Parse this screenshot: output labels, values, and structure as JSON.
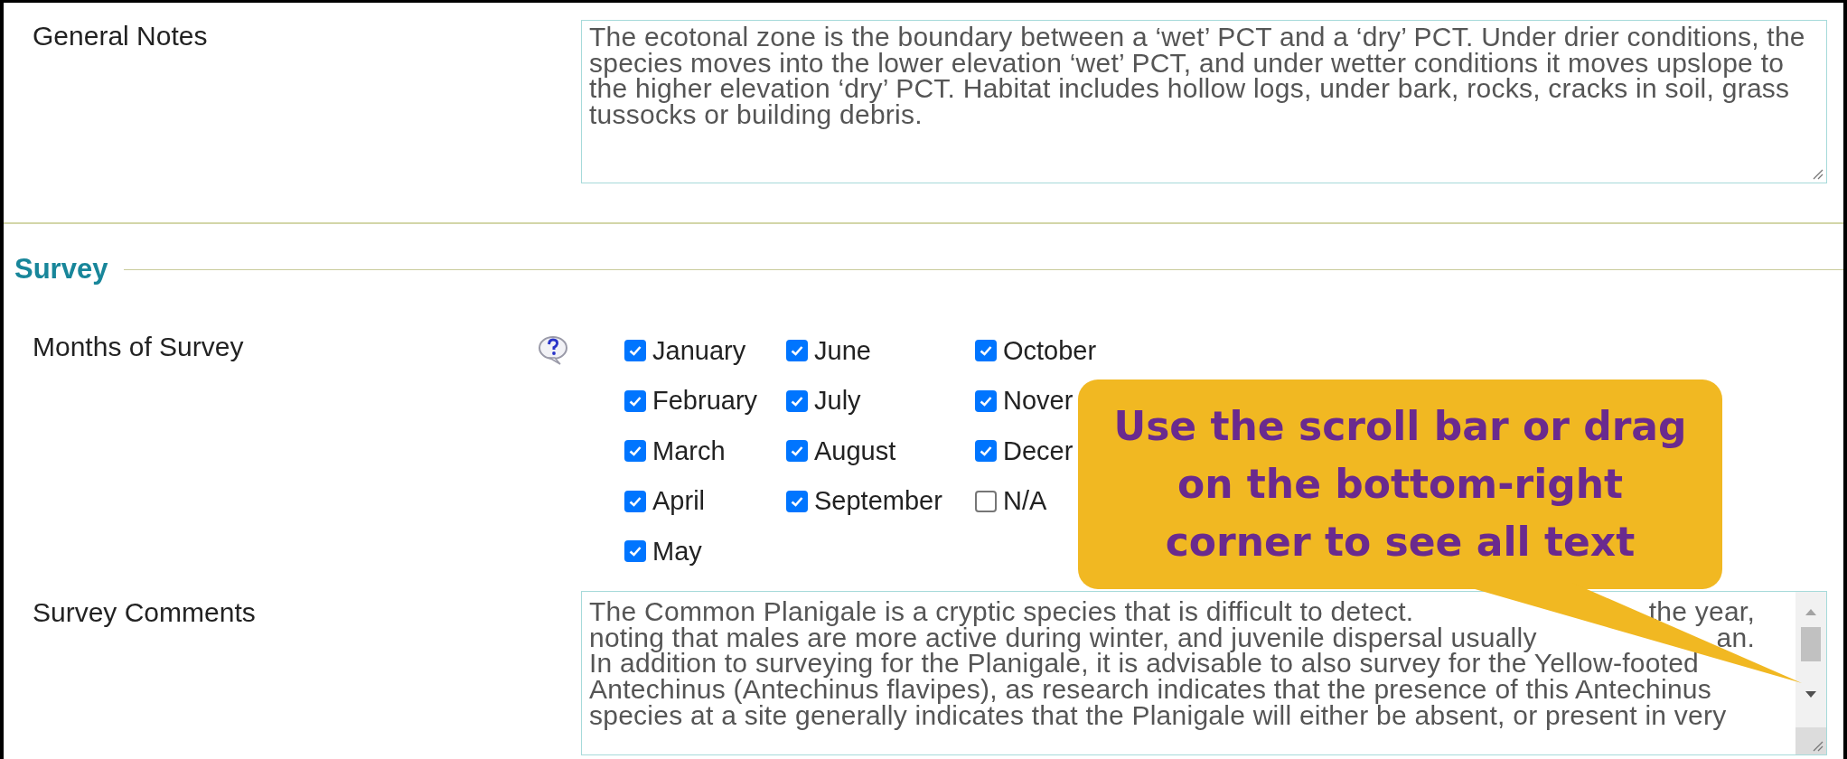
{
  "general_notes": {
    "label": "General Notes",
    "lines": [
      "The ecotonal zone is the boundary between a ‘wet’ PCT and a ‘dry’ PCT. Under drier conditions, the",
      "species moves into the lower elevation ‘wet’ PCT, and under wetter conditions it moves upslope to",
      "the higher elevation ‘dry’ PCT. Habitat includes hollow logs, under bark, rocks, cracks in soil, grass",
      "tussocks or building debris."
    ]
  },
  "survey": {
    "heading": "Survey",
    "months": {
      "label": "Months of Survey",
      "columns": [
        [
          {
            "label": "January",
            "checked": true
          },
          {
            "label": "February",
            "checked": true
          },
          {
            "label": "March",
            "checked": true
          },
          {
            "label": "April",
            "checked": true
          },
          {
            "label": "May",
            "checked": true
          }
        ],
        [
          {
            "label": "June",
            "checked": true
          },
          {
            "label": "July",
            "checked": true
          },
          {
            "label": "August",
            "checked": true
          },
          {
            "label": "September",
            "checked": true
          }
        ],
        [
          {
            "label": "October",
            "checked": true
          },
          {
            "label": "Nover",
            "checked": true
          },
          {
            "label": "Decer",
            "checked": true
          },
          {
            "label": "N/A",
            "checked": false
          }
        ]
      ]
    },
    "comments": {
      "label": "Survey Comments",
      "lines": [
        [
          "The Common Planigale is a cryptic species that is difficult to detect.",
          "the year,"
        ],
        [
          "noting that males are more active during winter, and juvenile dispersal usually",
          "an."
        ],
        [
          "In addition to surveying for the Planigale, it is advisable to also survey for the Yellow-footed"
        ],
        [
          "Antechinus (Antechinus flavipes), as research indicates that the presence of this Antechinus"
        ],
        [
          "species at a site generally indicates that the Planigale will either be absent, or present in very"
        ]
      ]
    }
  },
  "callout": {
    "lines": [
      "Use the scroll bar or drag",
      "on the bottom-right",
      "corner to see all text"
    ]
  }
}
